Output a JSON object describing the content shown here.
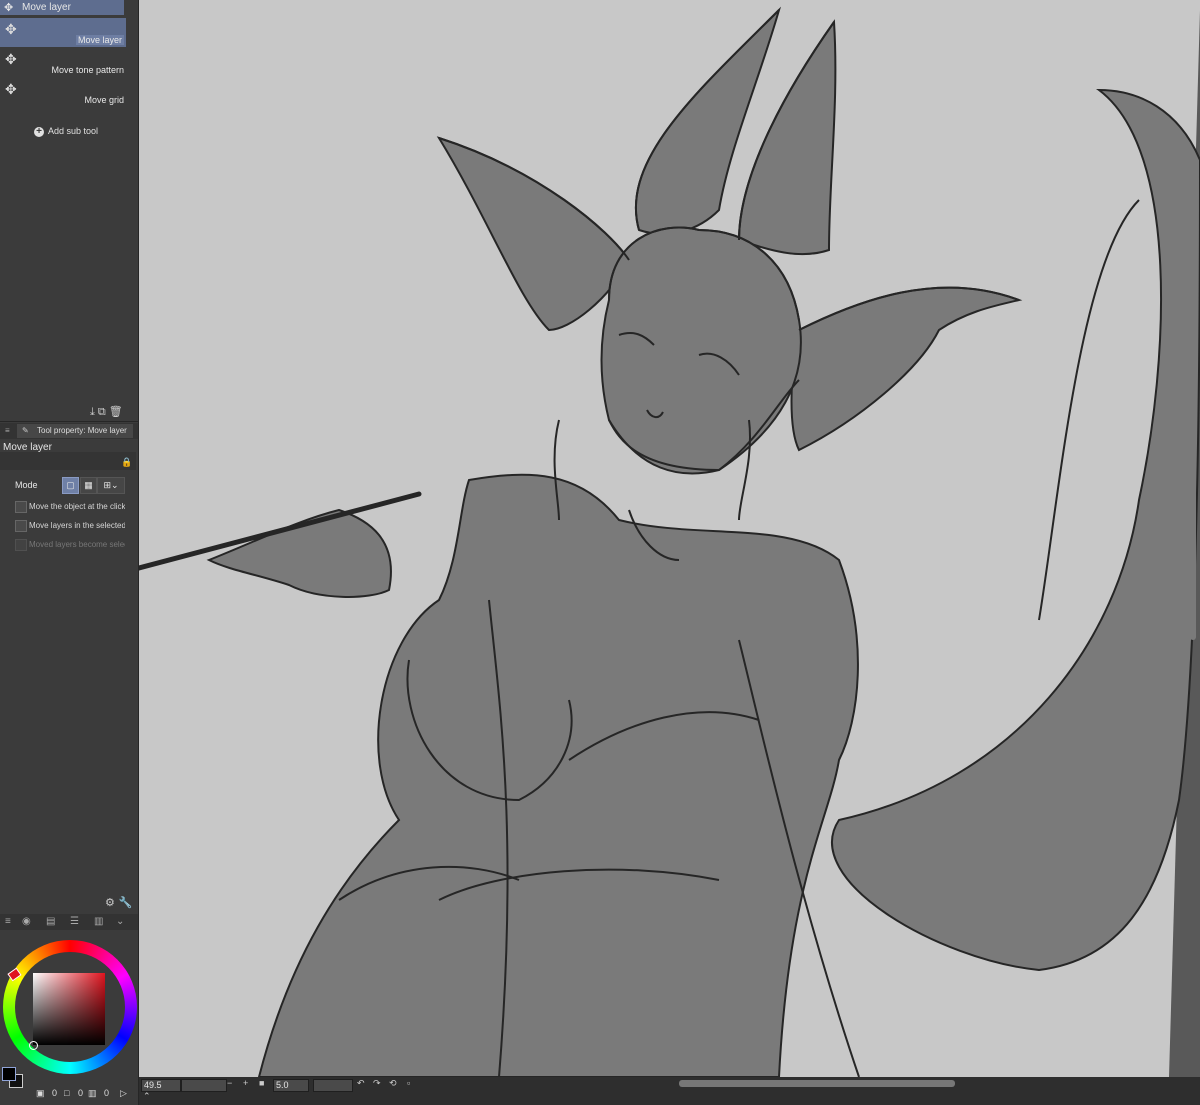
{
  "subtool": {
    "header_label": "Move layer",
    "items": [
      {
        "label": "Move layer",
        "icon": "move-cross-icon",
        "selected": true
      },
      {
        "label": "Move tone pattern",
        "icon": "move-cross-icon",
        "selected": false
      },
      {
        "label": "Move grid",
        "icon": "move-cross-icon",
        "selected": false
      }
    ],
    "add_label": "Add sub tool"
  },
  "tool_property": {
    "tab_label": "Tool property: Move layer",
    "title": "Move layer",
    "mode_label": "Mode",
    "checkboxes": [
      {
        "label": "Move the object at the clicked position",
        "checked": false,
        "disabled": false
      },
      {
        "label": "Move layers in the selected area",
        "checked": false,
        "disabled": false
      },
      {
        "label": "Moved layers become selected",
        "checked": false,
        "disabled": true
      }
    ]
  },
  "color": {
    "main_color": "#000000",
    "hue_color": "#e0141f",
    "footer_values": [
      "0",
      "0",
      "0"
    ]
  },
  "status": {
    "zoom": "49.5",
    "brush_size": "5.0"
  },
  "canvas": {
    "paper_color": "#c8c8c8",
    "fill_color": "#7a7a7a",
    "line_color": "#262626"
  }
}
